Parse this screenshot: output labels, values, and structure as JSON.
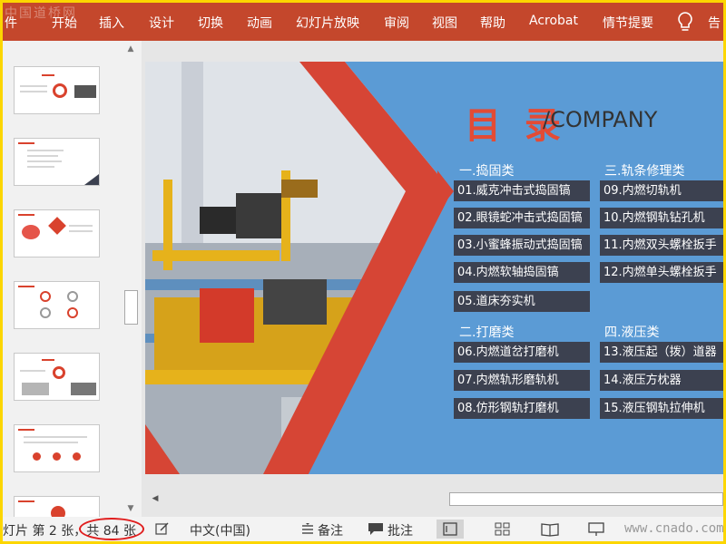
{
  "ribbon": {
    "watermark": "中国道桥网",
    "tabs": [
      "件",
      "开始",
      "插入",
      "设计",
      "切换",
      "动画",
      "幻灯片放映",
      "审阅",
      "视图",
      "帮助",
      "Acrobat",
      "情节提要"
    ],
    "tell_me": "告"
  },
  "slide": {
    "title_main": "目 录",
    "title_sub": "/COMPANY",
    "categories": [
      {
        "label": "一.捣固类",
        "items": [
          "01.威克冲击式捣固镐",
          "02.眼镜蛇冲击式捣固镐",
          "03.小蜜蜂振动式捣固镐",
          "04.内燃软轴捣固镐",
          "05.道床夯实机"
        ]
      },
      {
        "label": "三.轨条修理类",
        "items": [
          "09.内燃切轨机",
          "10.内燃钢轨钻孔机",
          "11.内燃双头螺栓扳手",
          "12.内燃单头螺栓扳手"
        ]
      },
      {
        "label": "二.打磨类",
        "items": [
          "06.内燃道岔打磨机",
          "07.内燃轨形磨轨机",
          "08.仿形钢轨打磨机"
        ]
      },
      {
        "label": "四.液压类",
        "items": [
          "13.液压起（拨）道器",
          "14.液压方枕器",
          "15.液压钢轨拉伸机"
        ]
      }
    ]
  },
  "status": {
    "slide_info": "灯片 第 2 张，共 84 张",
    "language": "中文(中国)",
    "notes": "备注",
    "comments": "批注",
    "watermark": "www.cnado.com"
  },
  "colors": {
    "ribbon": "#c4472c",
    "slide_bg": "#5b9bd5",
    "accent_red": "#e34b35",
    "item_bg": "#3c4150",
    "frame": "#fcd600"
  }
}
